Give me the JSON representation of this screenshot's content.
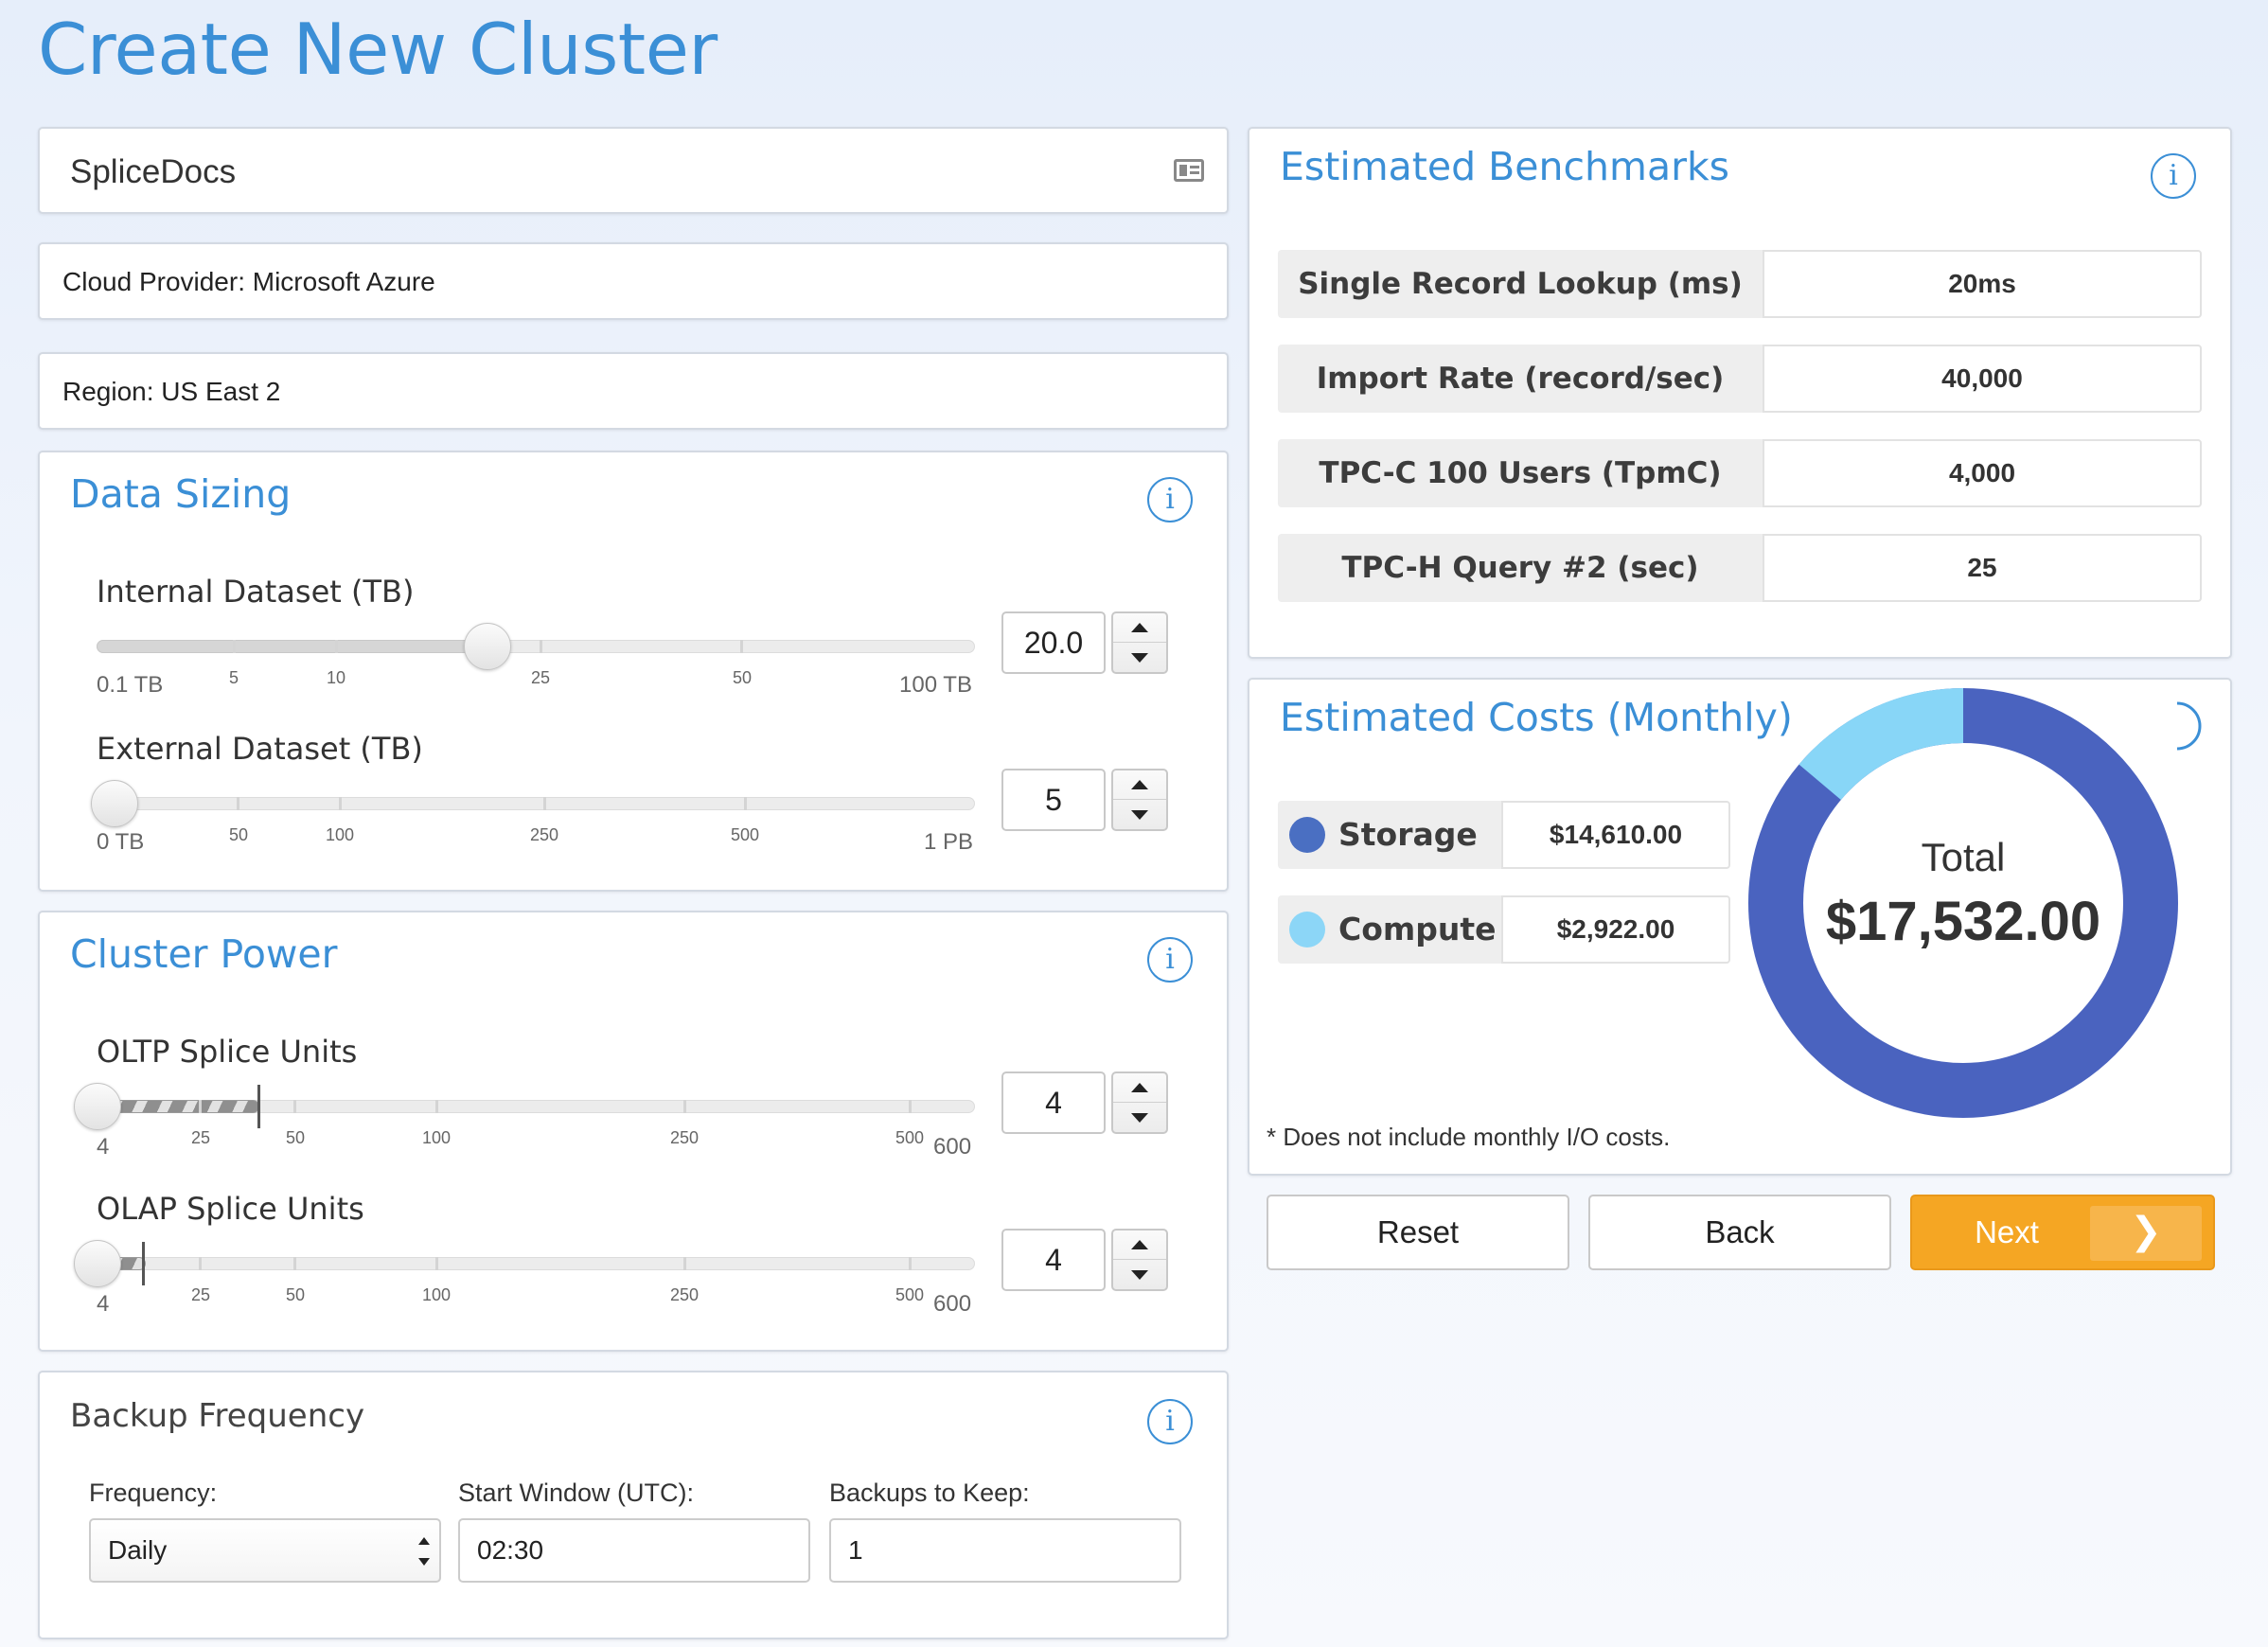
{
  "page": {
    "title": "Create New Cluster"
  },
  "cluster_name": {
    "value": "SpliceDocs",
    "icon": "id-card-icon"
  },
  "cloud_provider": {
    "text": "Cloud Provider: Microsoft Azure"
  },
  "region": {
    "text": "Region: US East 2"
  },
  "data_sizing": {
    "title": "Data Sizing",
    "internal": {
      "label": "Internal Dataset (TB)",
      "value": "20.0",
      "min_label": "0.1 TB",
      "max_label": "100 TB",
      "ticks": [
        "5",
        "10",
        "25",
        "50"
      ],
      "position_fraction": 0.44
    },
    "external": {
      "label": "External Dataset (TB)",
      "value": "5",
      "min_label": "0 TB",
      "max_label": "1 PB",
      "ticks": [
        "50",
        "100",
        "250",
        "500"
      ],
      "position_fraction": 0.0
    }
  },
  "cluster_power": {
    "title": "Cluster Power",
    "oltp": {
      "label": "OLTP Splice Units",
      "value": "4",
      "min_label": "4",
      "max_label": "600",
      "ticks": [
        "25",
        "50",
        "100",
        "250",
        "500"
      ]
    },
    "olap": {
      "label": "OLAP Splice Units",
      "value": "4",
      "min_label": "4",
      "max_label": "600",
      "ticks": [
        "25",
        "50",
        "100",
        "250",
        "500"
      ]
    }
  },
  "backup": {
    "title": "Backup Frequency",
    "frequency_label": "Frequency:",
    "frequency_value": "Daily",
    "start_label": "Start Window (UTC):",
    "start_value": "02:30",
    "keep_label": "Backups to Keep:",
    "keep_value": "1"
  },
  "benchmarks": {
    "title": "Estimated Benchmarks",
    "rows": [
      {
        "label": "Single Record Lookup (ms)",
        "value": "20ms"
      },
      {
        "label": "Import Rate (record/sec)",
        "value": "40,000"
      },
      {
        "label": "TPC-C 100 Users (TpmC)",
        "value": "4,000"
      },
      {
        "label": "TPC-H Query #2 (sec)",
        "value": "25"
      }
    ]
  },
  "costs": {
    "title": "Estimated Costs (Monthly)",
    "rows": [
      {
        "label": "Storage",
        "value": "$14,610.00",
        "color": "#4a6fc2"
      },
      {
        "label": "Compute",
        "value": "$2,922.00",
        "color": "#8cd6f7"
      }
    ],
    "total_label": "Total",
    "total_value": "$17,532.00",
    "note": "* Does not include monthly I/O costs.",
    "donut_colors": {
      "storage": "#4a63bf",
      "compute": "#88d6f7"
    }
  },
  "actions": {
    "reset": "Reset",
    "back": "Back",
    "next": "Next",
    "next_icon": "chevron-right-icon"
  }
}
